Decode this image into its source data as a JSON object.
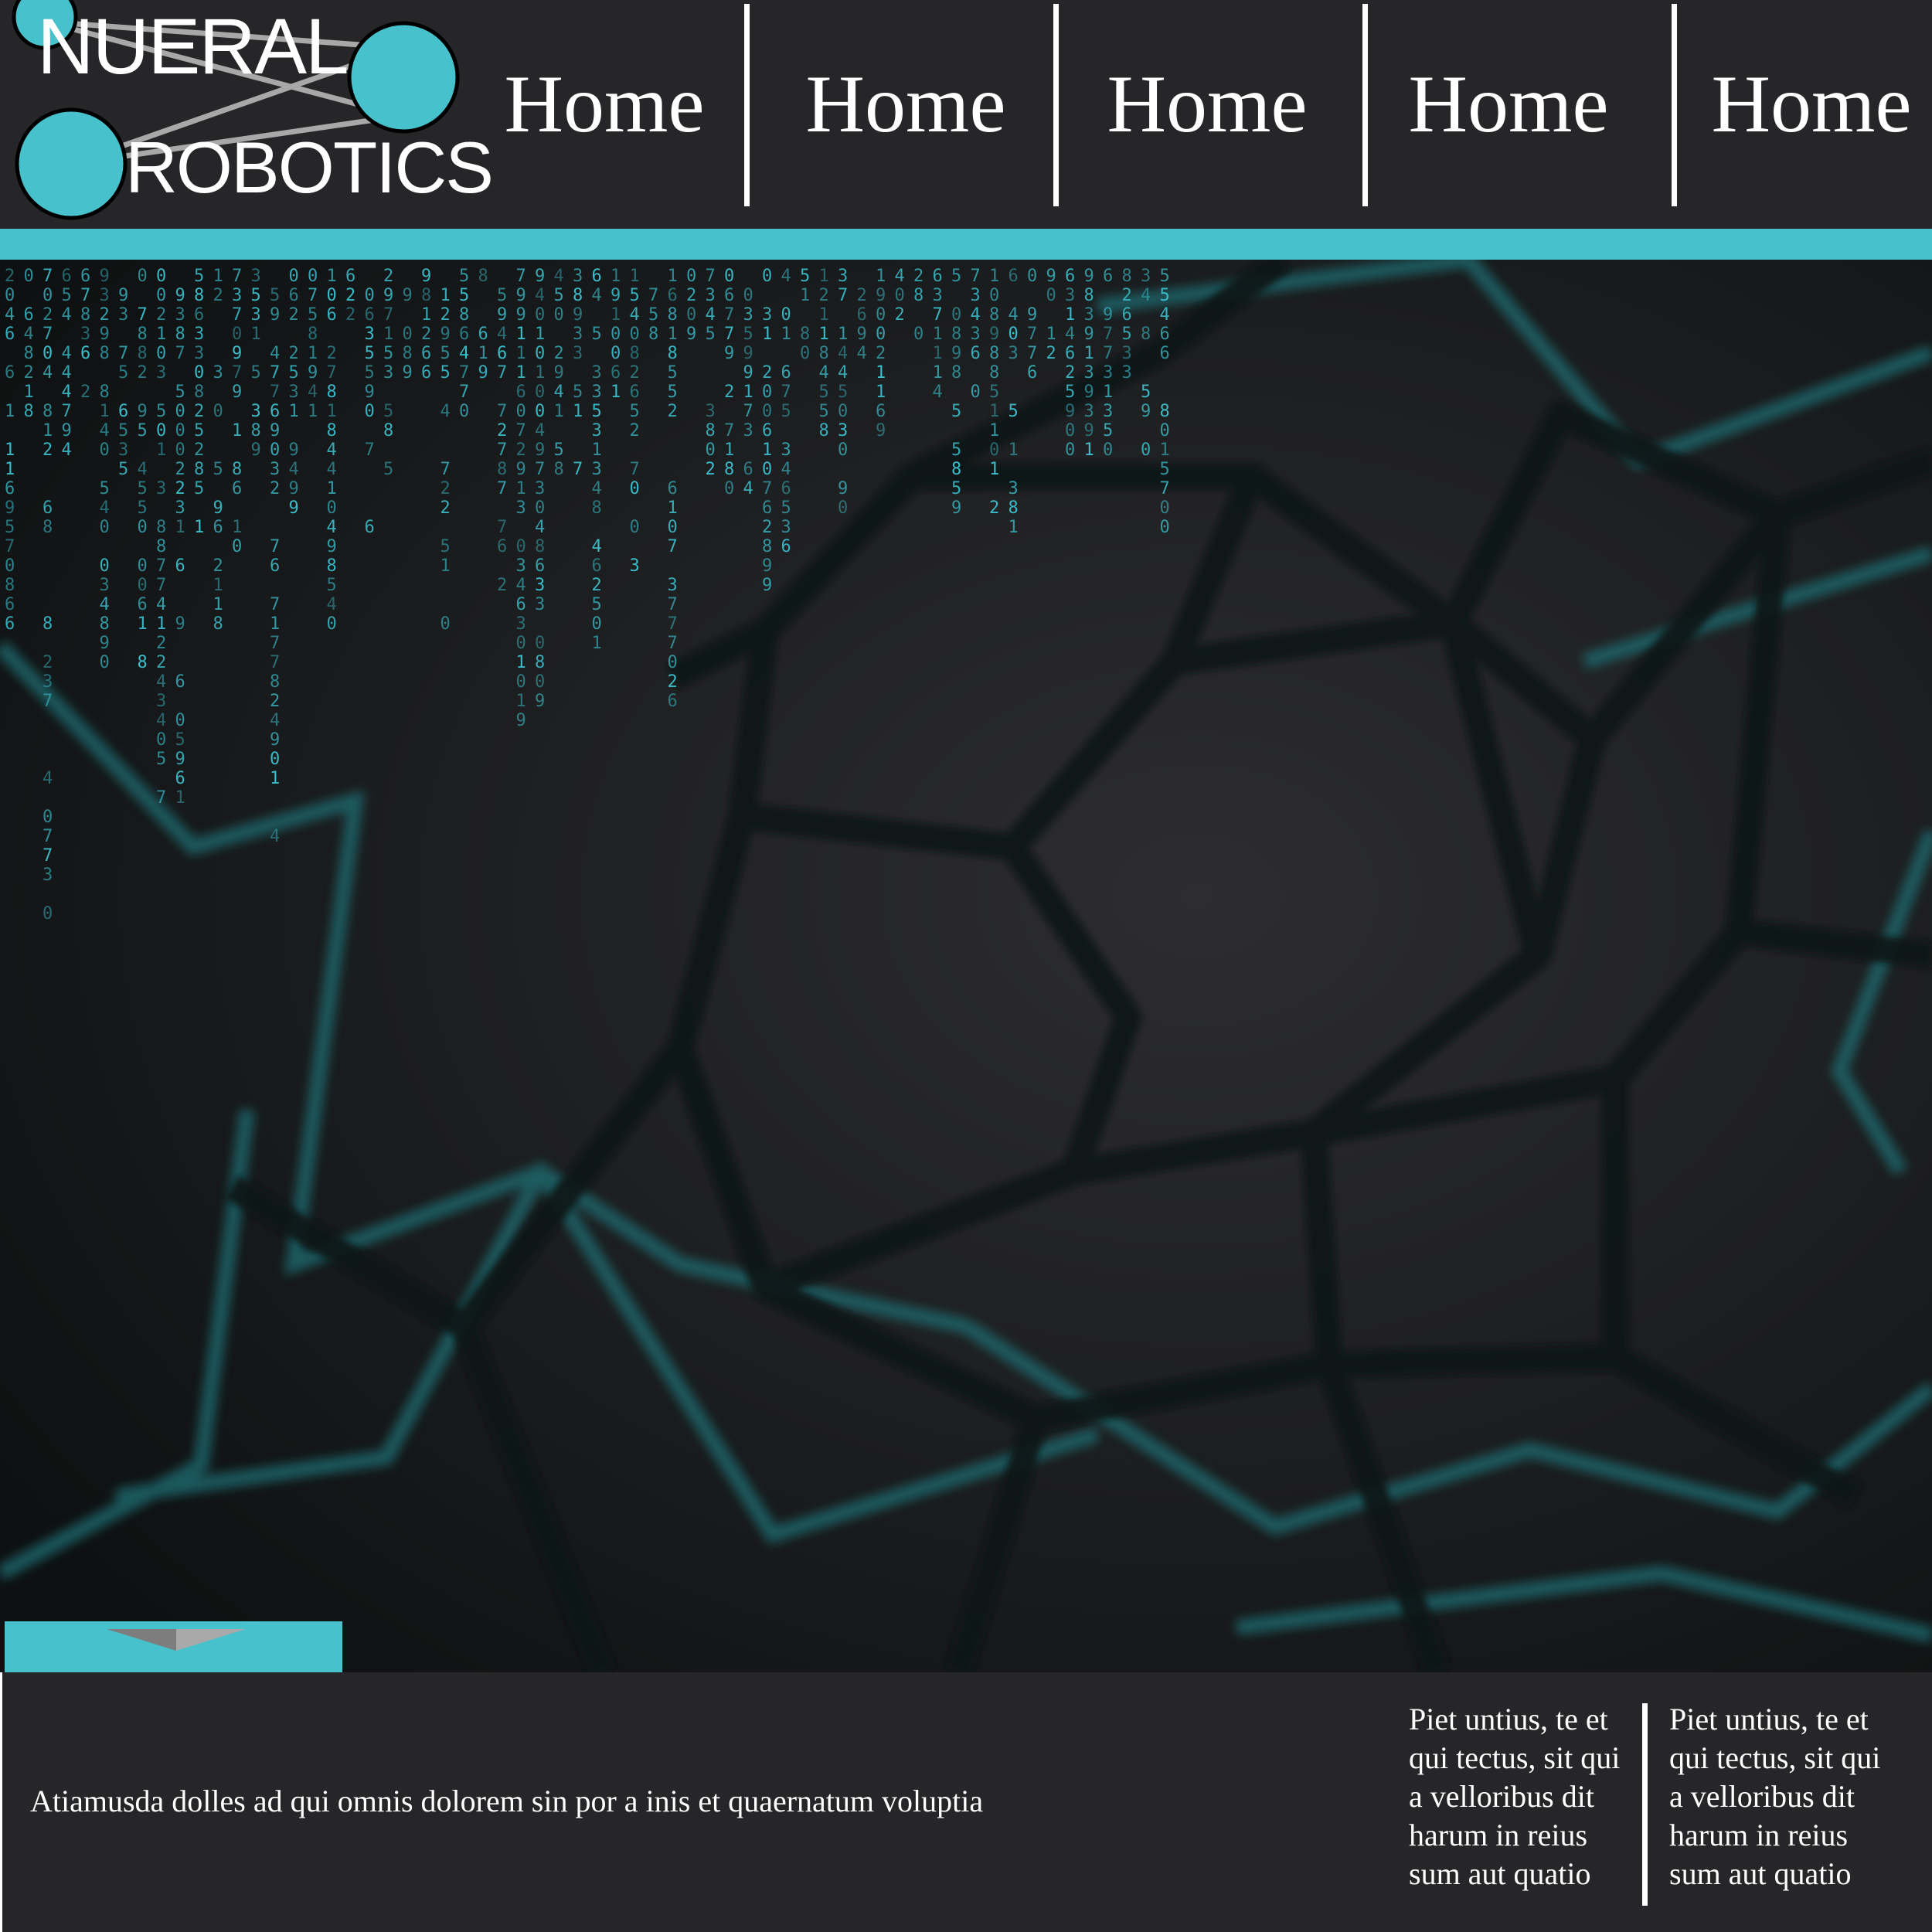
{
  "brand": {
    "name_top": "NUERAL",
    "name_bottom": "ROBOTICS",
    "accent_color": "#47c1cc",
    "background_color": "#262527"
  },
  "nav": {
    "items": [
      {
        "label": "Home"
      },
      {
        "label": "Home"
      },
      {
        "label": "Home"
      },
      {
        "label": "Home"
      },
      {
        "label": "Home"
      }
    ]
  },
  "hero": {
    "tab_icon": "triangle-down-icon"
  },
  "footer": {
    "text": "Atiamusda dolles ad qui omnis dolorem sin por a inis et quaernatum voluptia",
    "columns": [
      {
        "text": "Piet untius, te et qui tectus, sit qui a velloribus dit harum in reius sum aut quatio"
      },
      {
        "text": "Piet untius, te et qui tectus, sit qui a velloribus dit harum in reius sum aut quatio"
      }
    ]
  }
}
